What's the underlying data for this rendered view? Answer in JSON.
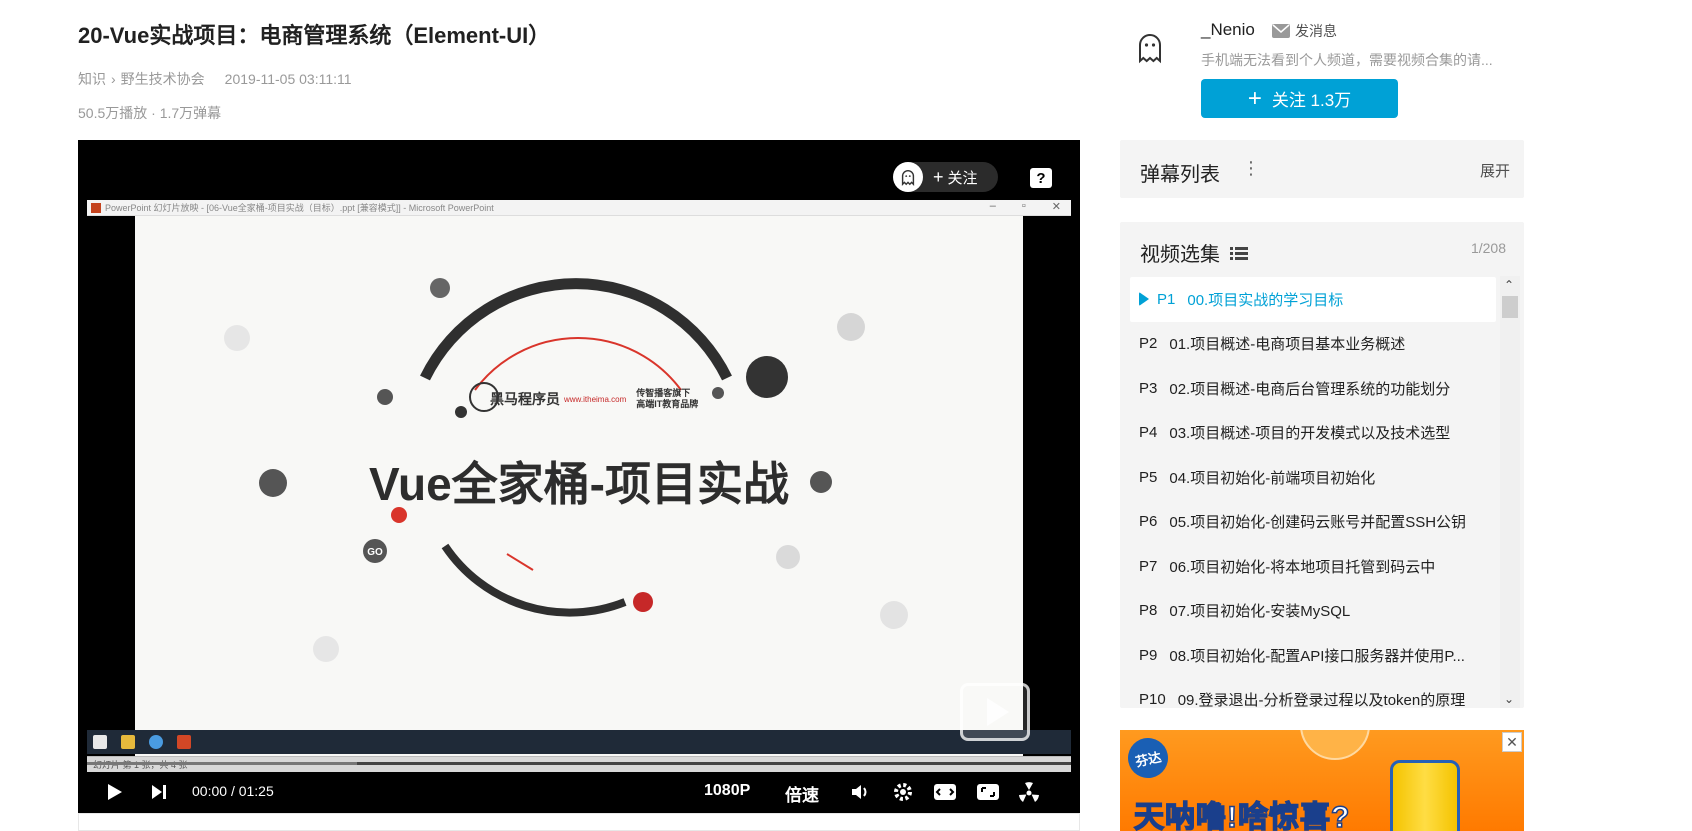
{
  "video": {
    "title": "20-Vue实战项目：电商管理系统（Element-UI）",
    "breadcrumb": [
      "知识",
      "野生技术协会"
    ],
    "breadcrumb_sep": "›",
    "publish_time": "2019-11-05 03:11:11",
    "stats": "50.5万播放 · 1.7万弹幕"
  },
  "player": {
    "follow_label": "关注",
    "help_label": "?",
    "ppt_window_title": "PowerPoint 幻灯片放映 - [06-Vue全家桶-项目实战（目标）.ppt [兼容模式]] - Microsoft PowerPoint",
    "ppt_status": "幻灯片 第 1 张，共 4 张",
    "slide": {
      "brand_name": "黑马程序员",
      "brand_url": "www.itheima.com",
      "brand_tagline_1": "传智播客旗下",
      "brand_tagline_2": "高端IT教育品牌",
      "heading": "Vue全家桶-项目实战",
      "go_label": "GO"
    },
    "current_time": "00:00",
    "time_sep": "/",
    "duration": "01:25",
    "quality": "1080P",
    "speed_label": "倍速",
    "progress_fraction": 0,
    "accent": "#00a1d6"
  },
  "uploader": {
    "name": "_Nenio",
    "message_label": "发消息",
    "description": "手机端无法看到个人频道，需要视频合集的请...",
    "follow_label": "关注 1.3万"
  },
  "danmaku": {
    "title": "弹幕列表",
    "expand_label": "展开"
  },
  "playlist": {
    "title": "视频选集",
    "count": "1/208",
    "items": [
      {
        "no": "P1",
        "title": "00.项目实战的学习目标",
        "active": true
      },
      {
        "no": "P2",
        "title": "01.项目概述-电商项目基本业务概述",
        "active": false
      },
      {
        "no": "P3",
        "title": "02.项目概述-电商后台管理系统的功能划分",
        "active": false
      },
      {
        "no": "P4",
        "title": "03.项目概述-项目的开发模式以及技术选型",
        "active": false
      },
      {
        "no": "P5",
        "title": "04.项目初始化-前端项目初始化",
        "active": false
      },
      {
        "no": "P6",
        "title": "05.项目初始化-创建码云账号并配置SSH公钥",
        "active": false
      },
      {
        "no": "P7",
        "title": "06.项目初始化-将本地项目托管到码云中",
        "active": false
      },
      {
        "no": "P8",
        "title": "07.项目初始化-安装MySQL",
        "active": false
      },
      {
        "no": "P9",
        "title": "08.项目初始化-配置API接口服务器并使用P...",
        "active": false
      },
      {
        "no": "P10",
        "title": "09.登录退出-分析登录过程以及token的原理",
        "active": false
      }
    ]
  },
  "ad": {
    "logo_text": "芬达",
    "slogan": "天呐噜!啥惊喜?",
    "close_label": "✕"
  }
}
